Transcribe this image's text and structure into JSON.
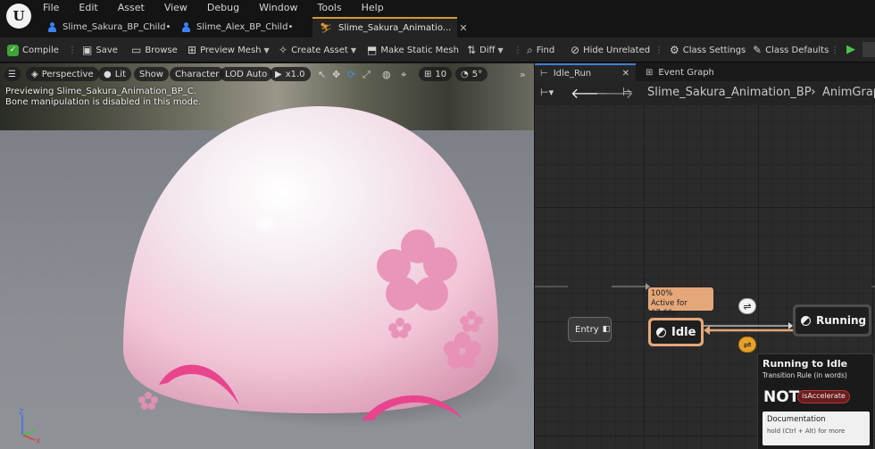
{
  "menu": [
    "File",
    "Edit",
    "Asset",
    "View",
    "Debug",
    "Window",
    "Tools",
    "Help"
  ],
  "tabs": [
    {
      "label": "Slime_Sakura_BP_Child",
      "modified": "•"
    },
    {
      "label": "Slime_Alex_BP_Child",
      "modified": "•"
    },
    {
      "label": "Slime_Sakura_Animatio...",
      "close": "✕"
    }
  ],
  "toolbar": {
    "compile": "Compile",
    "save": "Save",
    "browse": "Browse",
    "preview_mesh": "Preview Mesh",
    "create_asset": "Create Asset",
    "make_static_mesh": "Make Static Mesh",
    "diff": "Diff",
    "find": "Find",
    "hide_unrelated": "Hide Unrelated",
    "class_settings": "Class Settings",
    "class_defaults": "Class Defaults"
  },
  "viewport": {
    "perspective": "Perspective",
    "lit": "Lit",
    "show": "Show",
    "character": "Character",
    "lod": "LOD Auto",
    "speed": "x1.0",
    "grid_size": "10",
    "angle": "5°",
    "preview_note": "Previewing Slime_Sakura_Animation_BP_C.",
    "bone_note": "Bone manipulation is disabled in this mode.",
    "axis": {
      "z": "Z",
      "x": "X"
    }
  },
  "graph": {
    "tabs": [
      {
        "label": "Idle_Run",
        "close": "✕"
      },
      {
        "label": "Event Graph"
      }
    ],
    "breadcrumb": {
      "root": "Slime_Sakura_Animation_BP",
      "separator": "›",
      "child": "AnimGrap"
    },
    "entry": "Entry",
    "idle": "Idle",
    "running": "Running",
    "idle_badge": {
      "weight": "100%",
      "active": "Active for 67.66s"
    },
    "tooltip": {
      "title": "Running to Idle",
      "subtitle": "Transition Rule (in words)",
      "not": "NOT",
      "variable": "isAccelerate",
      "doc_title": "Documentation",
      "doc_hint": "hold (Ctrl + Alt) for more"
    }
  },
  "colors": {
    "accent_tab": "#d89a2e",
    "active_state": "#e5a77a",
    "play": "#4cc34a",
    "transition_active": "#e6a22a"
  }
}
